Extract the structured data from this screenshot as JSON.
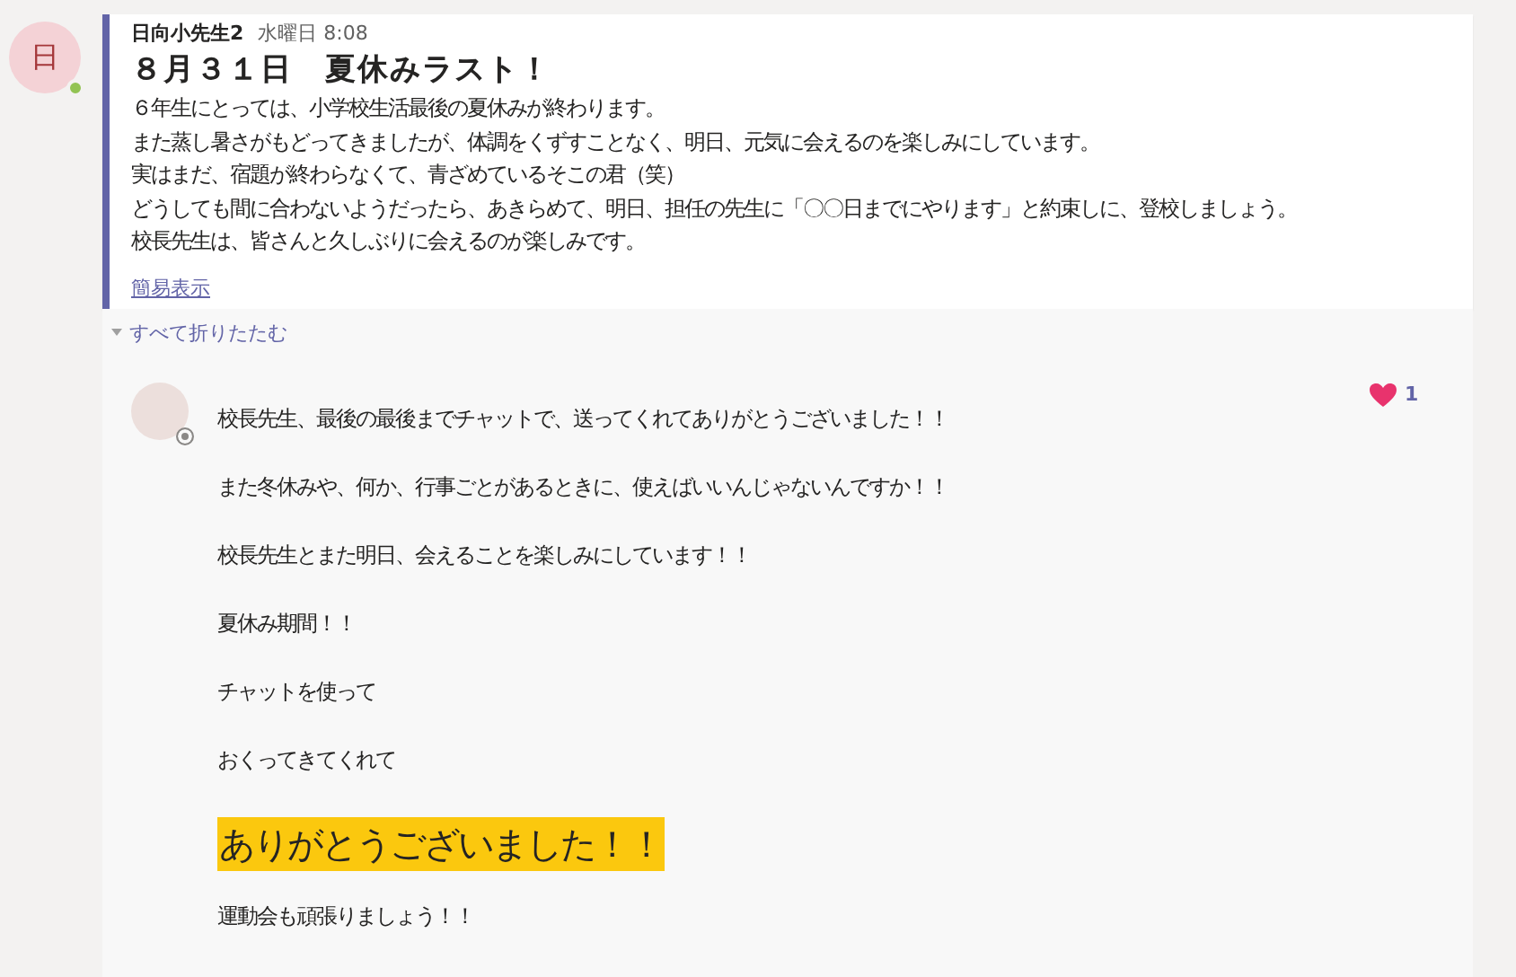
{
  "post": {
    "avatar": {
      "initial": "日",
      "online": true
    },
    "author": "日向小先生2",
    "time": "水曜日 8:08",
    "subject": "８月３１日　夏休みラスト！",
    "body": [
      "６年生にとっては、小学校生活最後の夏休みが終わります。",
      "また蒸し暑さがもどってきましたが、体調をくずすことなく、明日、元気に会えるのを楽しみにしています。",
      "実はまだ、宿題が終わらなくて、青ざめているそこの君（笑）",
      "どうしても間に合わないようだったら、あきらめて、明日、担任の先生に「〇〇日までにやります」と約束しに、登校しましょう。",
      "校長先生は、皆さんと久しぶりに会えるのが楽しみです。"
    ],
    "show_less": "簡易表示"
  },
  "replies_toggle": {
    "label": "すべて折りたたむ",
    "expanded": true
  },
  "replies": [
    {
      "avatar": {
        "online": false
      },
      "reaction": {
        "count": "1"
      },
      "lines": [
        {
          "kind": "normal",
          "text": "校長先生、最後の最後までチャットで、送ってくれてありがとうございました！！"
        },
        {
          "kind": "normal",
          "text": "また冬休みや、何か、行事ごとがあるときに、使えばいいんじゃないんですか！！"
        },
        {
          "kind": "normal",
          "text": "校長先生とまた明日、会えることを楽しみにしています！！"
        },
        {
          "kind": "normal",
          "text": "夏休み期間！！"
        },
        {
          "kind": "normal",
          "text": "チャットを使って"
        },
        {
          "kind": "normal",
          "text": "おくってきてくれて"
        },
        {
          "kind": "highlight",
          "text": "ありがとうございました！！"
        },
        {
          "kind": "normal",
          "text": "運動会も頑張りましょう！！"
        }
      ]
    }
  ]
}
